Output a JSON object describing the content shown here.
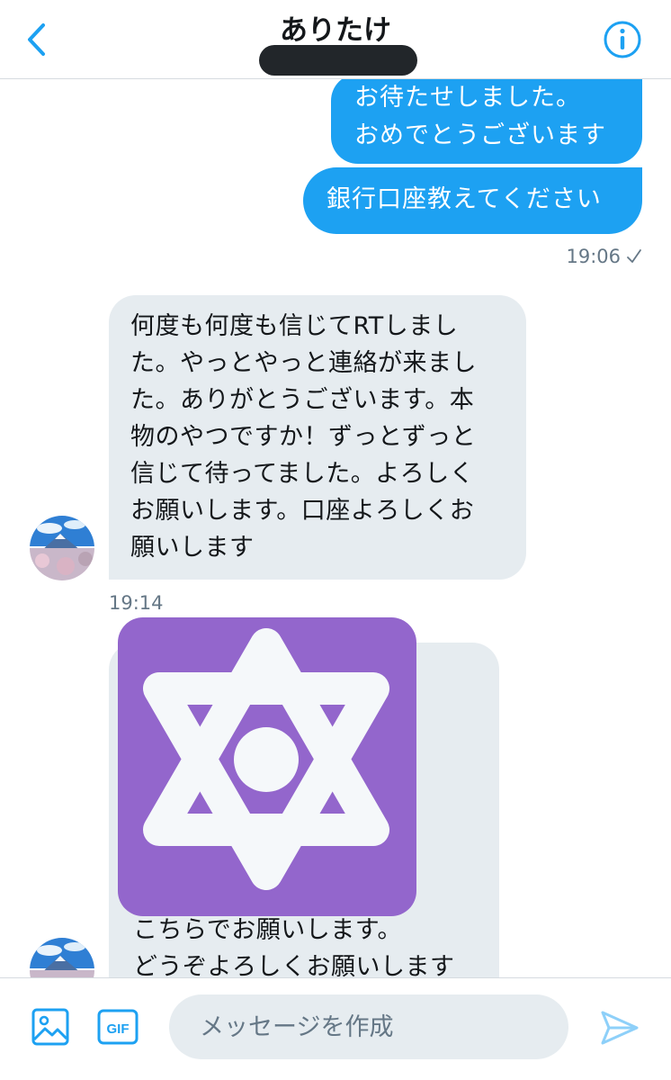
{
  "header": {
    "title": "ありたけ",
    "back_icon": "chevron-left-icon",
    "info_icon": "info-icon"
  },
  "messages": {
    "outgoing": [
      "お待たせしました。\nおめでとうございます",
      "銀行口座教えてください"
    ],
    "outgoing_time": "19:06",
    "incoming_text": "何度も何度も信じてRTしまし\nた。やっとやっと連絡が来まし\nた。ありがとうございます。本\n物のやつですか！ずっとずっと\n信じて待ってました。よろしく\nお願いします。口座よろしくお\n願いします",
    "incoming_time": "19:14",
    "media_caption": "こちらでお願いします。\nどうぞよろしくお願いします"
  },
  "composer": {
    "placeholder": "メッセージを作成",
    "gif_label": "GIF",
    "photo_icon": "image-icon",
    "send_icon": "send-icon"
  },
  "colors": {
    "accent": "#1da1f2",
    "incoming_bubble": "#e6ecf0",
    "media_tile": "#9366cc",
    "secondary_text": "#657786"
  }
}
